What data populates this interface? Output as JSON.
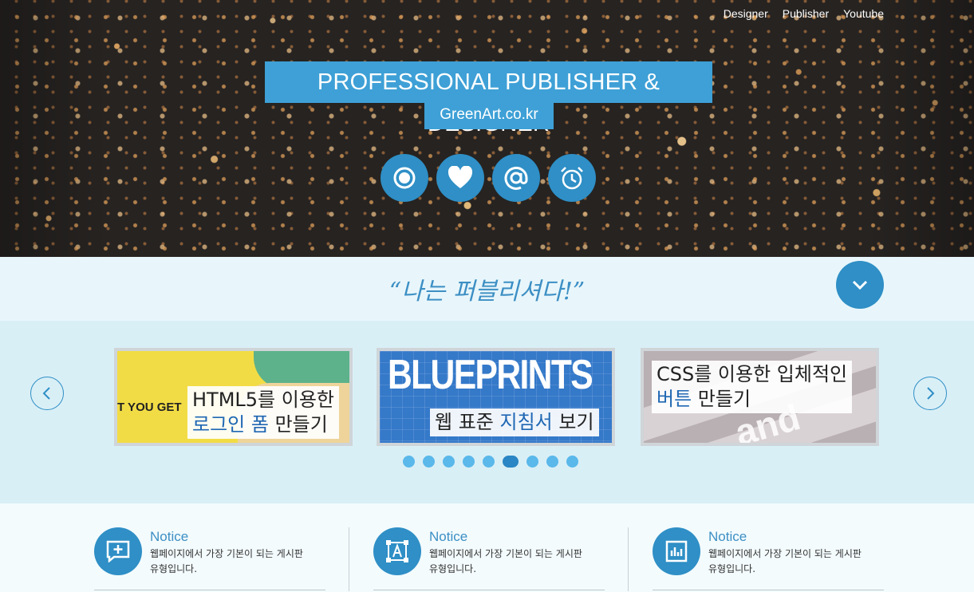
{
  "nav": {
    "items": [
      "Designer",
      "Publisher",
      "Youtube"
    ]
  },
  "hero": {
    "title": "PROFESSIONAL PUBLISHER & DESIGNER",
    "subtitle": "GreenArt.co.kr",
    "icons": [
      "target-icon",
      "heart-icon",
      "at-icon",
      "alarm-icon"
    ]
  },
  "quote": {
    "text": "“나는 퍼블리셔다!”"
  },
  "slider": {
    "cards": [
      {
        "bg_text": "T YOU GET",
        "line1": "HTML5를 이용한",
        "line2_hl": "로그인 폼",
        "line2_rest": " 만들기"
      },
      {
        "bg_text": "BLUEPRINTS",
        "line1_pre": "웹 표준 ",
        "line1_hl": "지침서",
        "line1_post": " 보기"
      },
      {
        "bg_text": "and inte",
        "line1": "CSS를 이용한 입체적인",
        "line2_hl": "버튼",
        "line2_rest": " 만들기"
      }
    ],
    "dot_count": 9,
    "active_dot": 6
  },
  "notices": [
    {
      "title": "Notice",
      "line1": "웹페이지에서 가장 기본이 되는 게시판",
      "line2": "유형입니다.",
      "icon": "plus-square-icon"
    },
    {
      "title": "Notice",
      "line1": "웹페이지에서 가장 기본이 되는 게시판",
      "line2": "유형입니다.",
      "icon": "letter-a-icon"
    },
    {
      "title": "Notice",
      "line1": "웹페이지에서 가장 기본이 되는 게시판",
      "line2": "유형입니다.",
      "icon": "bar-chart-icon"
    }
  ],
  "colors": {
    "accent": "#2f8fc6",
    "banner": "#3ea0d6",
    "highlight": "#1f67b3"
  }
}
